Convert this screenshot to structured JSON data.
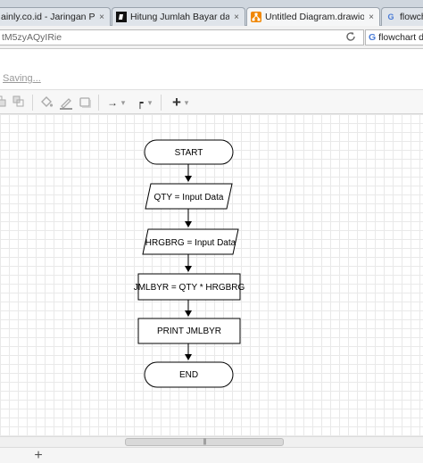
{
  "browser": {
    "tabs": [
      {
        "title": "ainly.co.id - Jaringan Pemb...",
        "favicon": "",
        "active": false
      },
      {
        "title": "Hitung Jumlah Bayar dari ban...",
        "favicon": "brainly-icon",
        "active": false
      },
      {
        "title": "Untitled Diagram.drawio - dra...",
        "favicon": "drawio-icon",
        "active": true
      },
      {
        "title": "flowchart",
        "favicon": "google-icon",
        "active": false
      }
    ],
    "close_glyph": "×",
    "url": "tM5zyAQyIRie",
    "search": {
      "engine_glyph": "G",
      "text": "flowchart di"
    }
  },
  "app": {
    "status": "Saving...",
    "toolbar": {
      "connector_glyph": "→",
      "waypoint_glyph": "┍",
      "insert_glyph": "+",
      "dropdown_glyph": "▾"
    }
  },
  "scroll": {
    "thumb_glyph": "|||"
  },
  "pagebar": {
    "add_page_glyph": "+"
  },
  "diagram": {
    "nodes": [
      {
        "id": "start",
        "shape": "terminator",
        "label": "START"
      },
      {
        "id": "input-qty",
        "shape": "parallelogram",
        "label": "QTY = Input Data"
      },
      {
        "id": "input-hrgbrg",
        "shape": "parallelogram",
        "label": "HRGBRG = Input Data"
      },
      {
        "id": "process",
        "shape": "rectangle",
        "label": "JMLBYR = QTY * HRGBRG"
      },
      {
        "id": "print",
        "shape": "rectangle",
        "label": "PRINT JMLBYR"
      },
      {
        "id": "end",
        "shape": "terminator",
        "label": "END"
      }
    ]
  }
}
